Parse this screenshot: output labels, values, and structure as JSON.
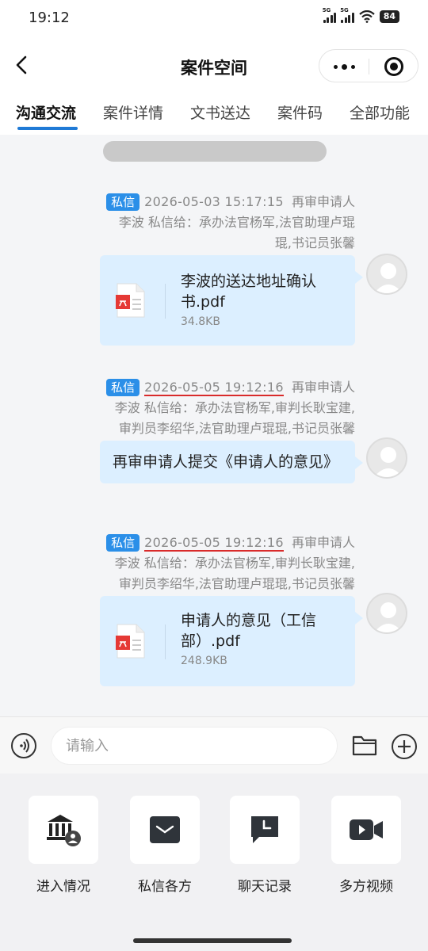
{
  "status_bar": {
    "time": "19:12",
    "signal_1_label": "5G",
    "signal_2_label": "5G",
    "battery": "84"
  },
  "header": {
    "title": "案件空间",
    "back_icon": "chevron-left-icon",
    "more_icon": "more-dots-icon",
    "target_icon": "target-circle-icon"
  },
  "tabs": [
    {
      "label": "沟通交流",
      "active": true
    },
    {
      "label": "案件详情",
      "active": false
    },
    {
      "label": "文书送达",
      "active": false
    },
    {
      "label": "案件码",
      "active": false
    },
    {
      "label": "全部功能",
      "active": false
    }
  ],
  "chat": {
    "messages": [
      {
        "tag": "私信",
        "timestamp": "2026-05-03 15:17:15",
        "sender_role": "再审申请人",
        "recipients_line_1": "李波  私信给：承办法官杨军,法官助理卢琨",
        "recipients_line_2": "琨,书记员张馨",
        "file_name": "李波的送达地址确认书.pdf",
        "file_size": "34.8KB",
        "timestamp_underlined": false
      },
      {
        "tag": "私信",
        "timestamp": "2026-05-05 19:12:16",
        "sender_role": "再审申请人",
        "recipients_line_1": "李波  私信给：承办法官杨军,审判长耿宝建,",
        "recipients_line_2": "审判员李绍华,法官助理卢琨琨,书记员张馨",
        "text": "再审申请人提交《申请人的意见》",
        "timestamp_underlined": true
      },
      {
        "tag": "私信",
        "timestamp": "2026-05-05 19:12:16",
        "sender_role": "再审申请人",
        "recipients_line_1": "李波  私信给：承办法官杨军,审判长耿宝建,",
        "recipients_line_2": "审判员李绍华,法官助理卢琨琨,书记员张馨",
        "file_name": "申请人的意见（工信部）.pdf",
        "file_size": "248.9KB",
        "timestamp_underlined": true
      }
    ]
  },
  "input_bar": {
    "placeholder": "请输入",
    "voice_icon": "voice-icon",
    "folder_icon": "folder-icon",
    "plus_icon": "plus-circle-icon"
  },
  "functions": [
    {
      "label": "进入情况",
      "icon": "court-user-icon"
    },
    {
      "label": "私信各方",
      "icon": "envelope-icon"
    },
    {
      "label": "聊天记录",
      "icon": "chat-clock-icon"
    },
    {
      "label": "多方视频",
      "icon": "video-camera-icon"
    }
  ],
  "colors": {
    "accent": "#2b8fe8",
    "tab_underline": "#1f7ad6",
    "bubble": "#dcefff",
    "underline_red": "#d92b2b",
    "pdf_red": "#e53935"
  }
}
